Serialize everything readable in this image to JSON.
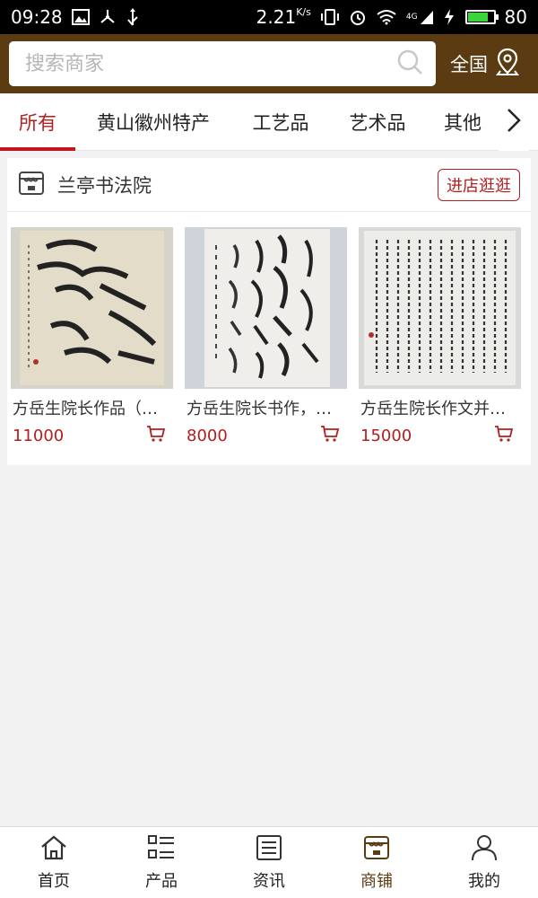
{
  "status_bar": {
    "time": "09:28",
    "speed": "2.21",
    "speed_unit": "K/s",
    "network": "4G",
    "battery": "80",
    "battery_fraction": 0.8
  },
  "search": {
    "placeholder": "搜索商家",
    "region_label": "全国"
  },
  "category_tabs": [
    {
      "label": "所有",
      "active": true
    },
    {
      "label": "黄山徽州特产",
      "active": false
    },
    {
      "label": "工艺品",
      "active": false
    },
    {
      "label": "艺术品",
      "active": false
    },
    {
      "label": "其他",
      "active": false
    }
  ],
  "shop": {
    "name": "兰亭书法院",
    "enter_label": "进店逛逛",
    "products": [
      {
        "title": "方岳生院长作品（…",
        "price": "11000"
      },
      {
        "title": "方岳生院长书作，…",
        "price": "8000"
      },
      {
        "title": "方岳生院长作文并…",
        "price": "15000"
      }
    ]
  },
  "bottom_nav": [
    {
      "label": "首页",
      "icon": "home-icon",
      "active": false
    },
    {
      "label": "产品",
      "icon": "list-icon",
      "active": false
    },
    {
      "label": "资讯",
      "icon": "news-icon",
      "active": false
    },
    {
      "label": "商铺",
      "icon": "store-icon",
      "active": true
    },
    {
      "label": "我的",
      "icon": "user-icon",
      "active": false
    }
  ],
  "colors": {
    "header_brown": "#5a3b12",
    "accent_red": "#b31e1e",
    "background": "#f2f2f2"
  }
}
